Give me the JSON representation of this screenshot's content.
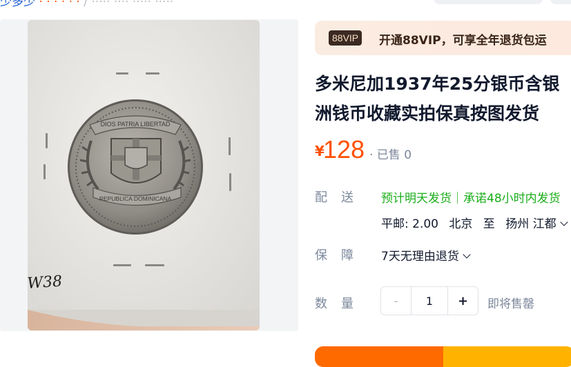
{
  "breadcrumb": {
    "part1": "少多少",
    "part2": "·  ·  ·  ·  ·  ·",
    "grey": "/  ·····  ····  ·····  ·····"
  },
  "vip": {
    "badge": "88VIP",
    "text": "开通88VIP，可享全年退货包运"
  },
  "product": {
    "title_line1": "多米尼加1937年25分银币含银",
    "title_line2": "洲钱币收藏实拍保真按图发货",
    "currency": "¥",
    "price": "128",
    "sold": "· 已售 0"
  },
  "delivery": {
    "label": [
      "配",
      "送"
    ],
    "promise": "预计明天发货｜承诺48小时内发货",
    "postage": "平邮: 2.00",
    "from": "北京",
    "to_word": "至",
    "to": "扬州 江都"
  },
  "guarantee": {
    "label": [
      "保",
      "障"
    ],
    "value": "7天无理由退货"
  },
  "quantity": {
    "label": [
      "数",
      "量"
    ],
    "minus": "-",
    "value": "1",
    "plus": "+",
    "status": "即将售罄"
  },
  "coin": {
    "top_text": "DIOS PATRIA LIBERTAD",
    "bottom_text": "REPUBLICA DOMINICANA",
    "handwriting": "W38"
  },
  "colors": {
    "accent": "#ff5000",
    "green": "#1aad19",
    "muted": "#7c889c"
  }
}
